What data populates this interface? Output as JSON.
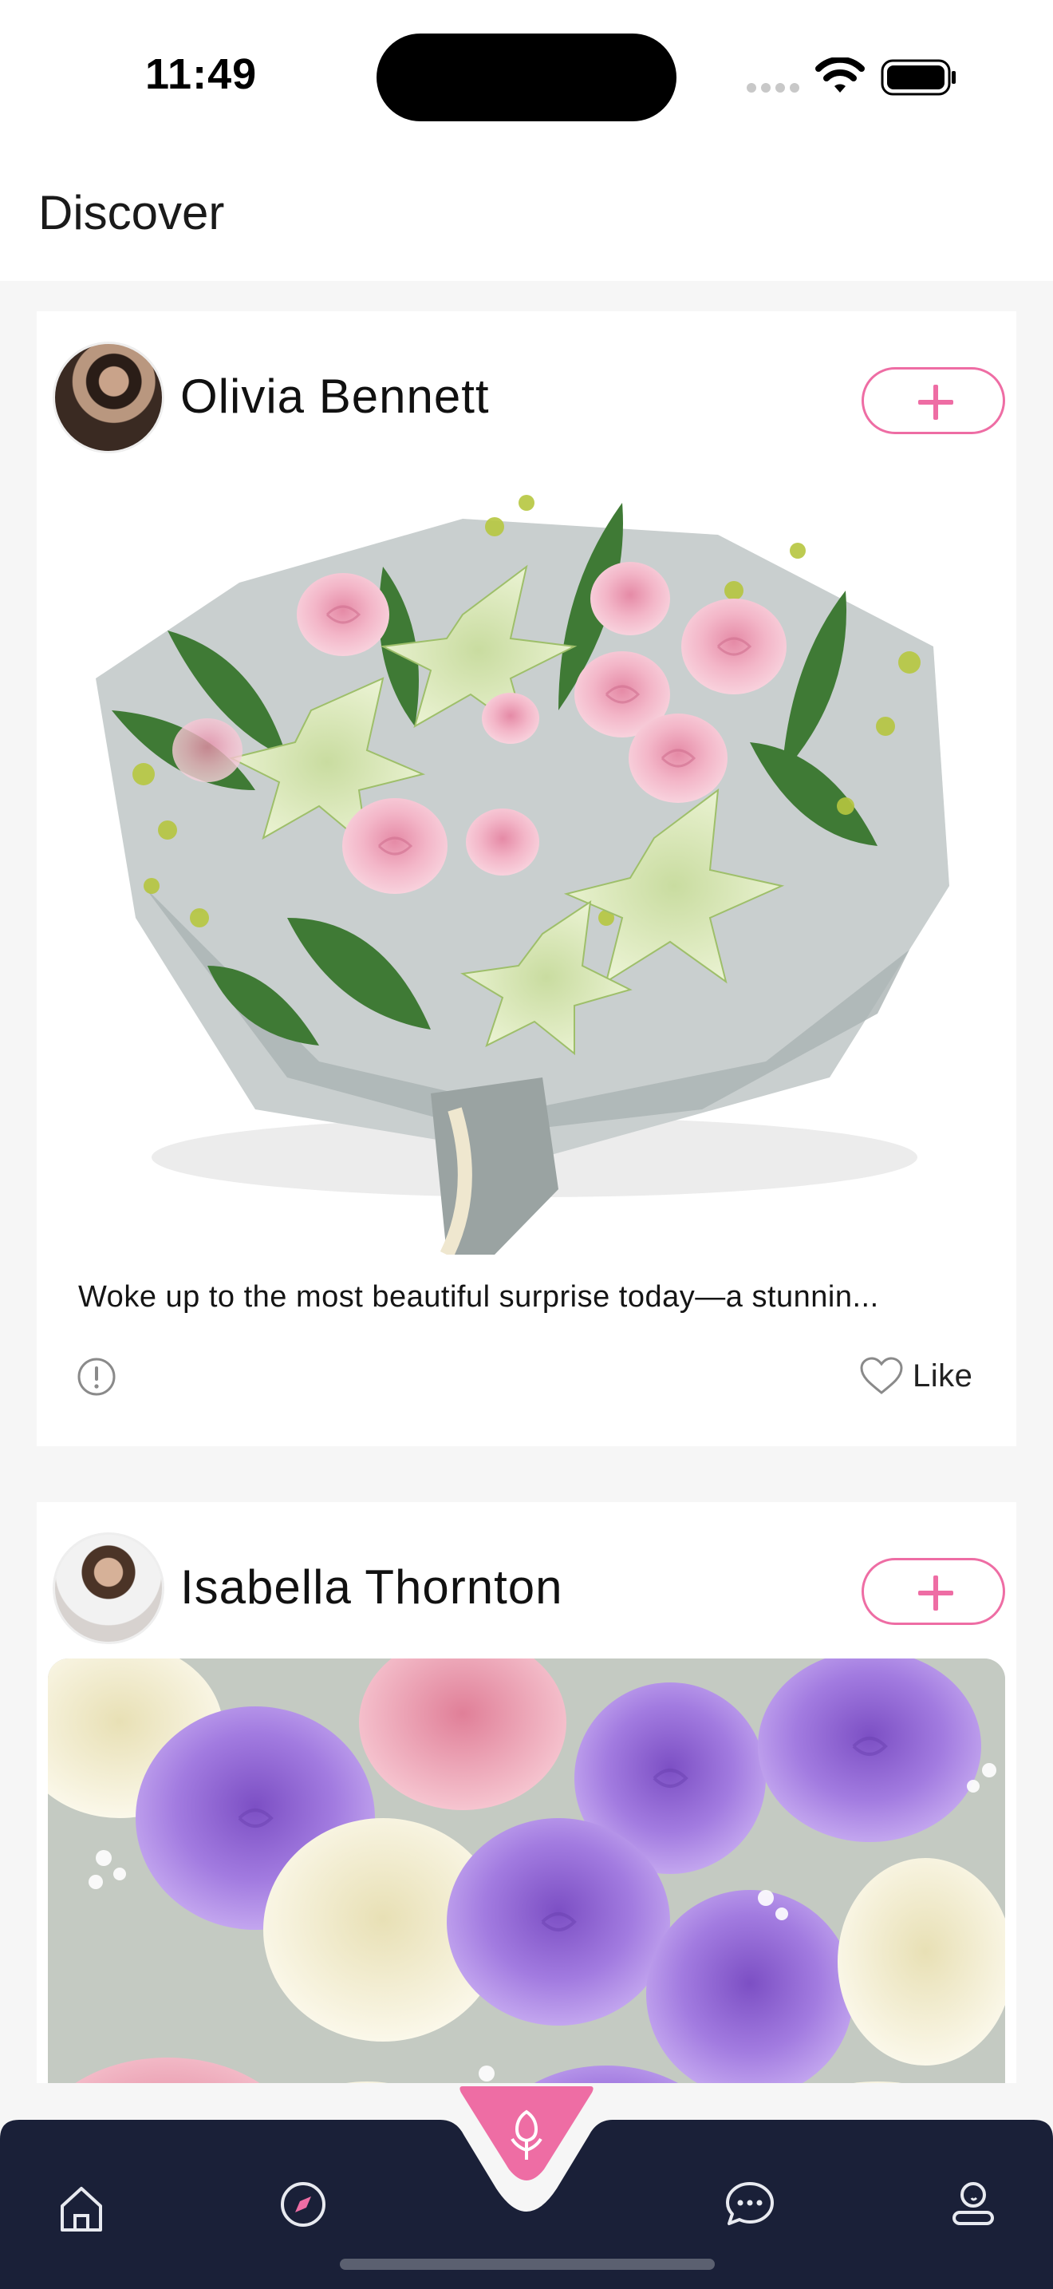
{
  "status_bar": {
    "time": "11:49",
    "icons": [
      "signal-icon",
      "wifi-icon",
      "battery-icon"
    ]
  },
  "header": {
    "title": "Discover"
  },
  "feed": {
    "posts": [
      {
        "author": "Olivia Bennett",
        "follow_icon": "plus-icon",
        "caption": "Woke up to the most beautiful surprise today—a stunnin...",
        "like_label": "Like",
        "report_icon": "alert-circle-icon",
        "like_icon": "heart-icon"
      },
      {
        "author": "Isabella Thornton",
        "follow_icon": "plus-icon"
      }
    ]
  },
  "tabbar": {
    "items": [
      "home-icon",
      "compass-icon",
      "flower-icon",
      "chat-icon",
      "profile-icon"
    ],
    "background": "#1a2038",
    "accent": "#ee6da4"
  },
  "colors": {
    "accent": "#ee6da4",
    "background": "#f6f6f6",
    "card": "#ffffff",
    "tabbar": "#1a2038"
  }
}
